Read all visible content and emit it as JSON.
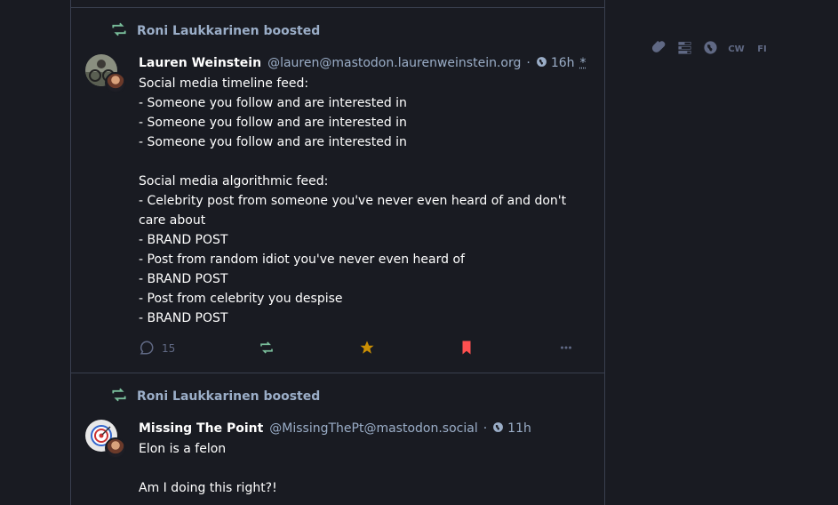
{
  "posts": [
    {
      "booster": "Roni Laukkarinen boosted",
      "display_name": "Lauren Weinstein",
      "acct": "@lauren@mastodon.laurenweinstein.org",
      "visibility_icon": "globe-icon",
      "time": "16h",
      "edited_mark": "*",
      "content": "Social media timeline feed:\n- Someone you follow and are interested in\n- Someone you follow and are interested in\n- Someone you follow and are interested in\n\nSocial media algorithmic feed:\n- Celebrity post from someone you've never even heard of and don't care about\n- BRAND POST\n- Post from random idiot you've never even heard of\n- BRAND POST\n- Post from celebrity you despise\n- BRAND POST",
      "replies_count": "15",
      "colors": {
        "favourite": "#ca8f04",
        "bookmark": "#ff5050",
        "boost_active": "#79bd9a"
      }
    },
    {
      "booster": "Roni Laukkarinen boosted",
      "display_name": "Missing The Point",
      "acct": "@MissingThePt@mastodon.social",
      "visibility_icon": "globe-icon",
      "time": "11h",
      "content": "Elon is a felon\n\nAm I doing this right?!"
    }
  ],
  "compose_toolbar": {
    "items": [
      "paperclip-icon",
      "poll-icon",
      "globe-icon"
    ],
    "cw_label": "CW",
    "lang_label": "FI"
  }
}
